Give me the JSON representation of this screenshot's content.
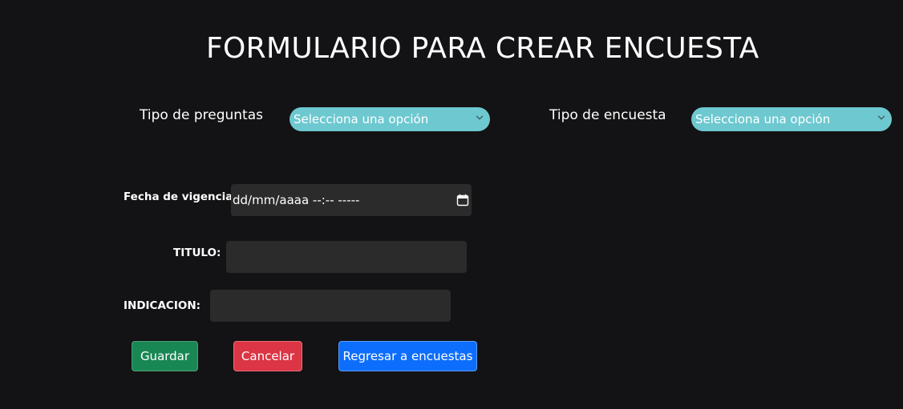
{
  "header": {
    "title": "FORMULARIO PARA CREAR ENCUESTA"
  },
  "form": {
    "tipo_preguntas": {
      "label": "Tipo de preguntas",
      "selected": "Selecciona una opción"
    },
    "tipo_encuesta": {
      "label": "Tipo de encuesta",
      "selected": "Selecciona una opción"
    },
    "fecha": {
      "label": "Fecha de vigencia",
      "placeholder": "dd/mm/aaaa --:-- -----"
    },
    "titulo": {
      "label": "TITULO:",
      "value": ""
    },
    "indicacion": {
      "label": "INDICACION:",
      "value": ""
    }
  },
  "buttons": {
    "guardar": "Guardar",
    "cancelar": "Cancelar",
    "regresar": "Regresar a encuestas"
  },
  "colors": {
    "background": "#131214",
    "select": "#6ec8d0",
    "input": "#2b2b2b",
    "green": "#198754",
    "red": "#dc3545",
    "blue": "#0d6efd"
  },
  "icons": {
    "select_chevron": "chevron-down-icon",
    "date_picker": "calendar-icon"
  }
}
